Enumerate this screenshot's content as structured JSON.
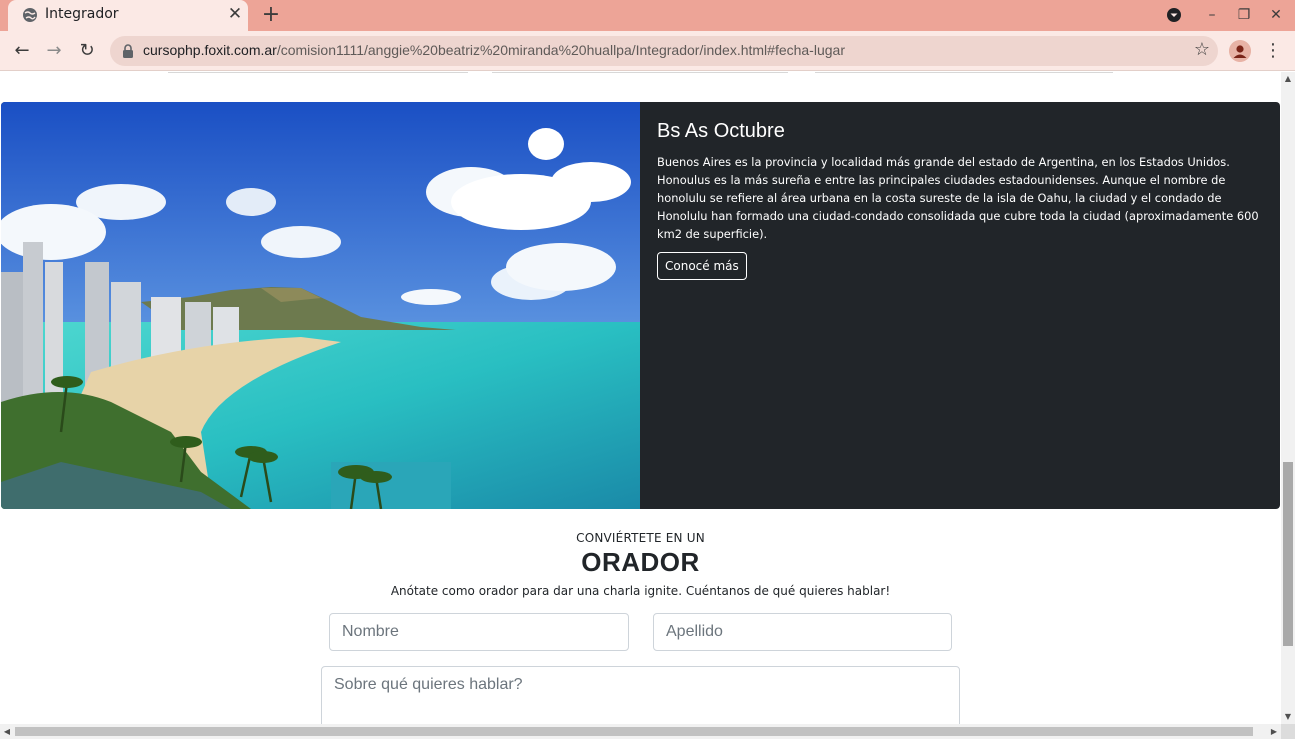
{
  "browser": {
    "tab_title": "Integrador",
    "tab_close": "✕",
    "new_tab": "+",
    "url_host": "cursophp.foxit.com.ar",
    "url_path": "/comision1111/anggie%20beatriz%20miranda%20huallpa/Integrador/index.html#fecha-lugar",
    "back": "←",
    "forward": "→",
    "reload": "↻",
    "bookmark": "☆",
    "menu": "⋮",
    "minimize": "–",
    "restore": "❐",
    "close": "✕"
  },
  "card": {
    "title": "Bs As Octubre",
    "text": "Buenos Aires es la provincia y localidad más grande del estado de Argentina, en los Estados Unidos. Honoulus es la más sureña e entre las principales ciudades estadounidenses. Aunque el nombre de honolulu se refiere al área urbana en la costa sureste de la isla de Oahu, la ciudad y el condado de Honolulu han formado una ciudad-condado consolidada que cubre toda la ciudad (aproximadamente 600 km2 de superficie).",
    "button": "Conocé más"
  },
  "orador": {
    "kicker": "CONVIÉRTETE EN UN",
    "heading": "ORADOR",
    "subtitle": "Anótate como orador para dar una charla ignite. Cuéntanos de qué quieres hablar!",
    "nombre_placeholder": "Nombre",
    "apellido_placeholder": "Apellido",
    "tema_placeholder": "Sobre qué quieres hablar?"
  },
  "colors": {
    "tabbar": "#eda497",
    "toolbar": "#fbe9e5",
    "card_bg": "#212529"
  }
}
